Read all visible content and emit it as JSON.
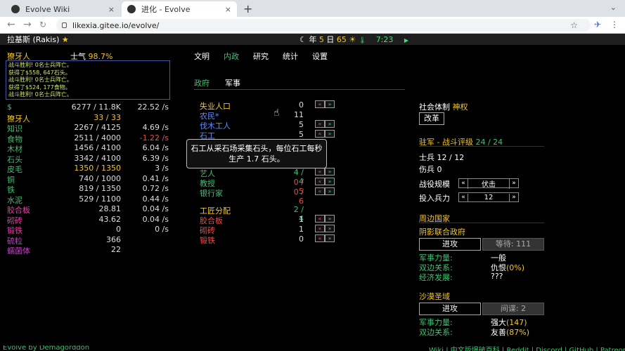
{
  "browser": {
    "tabs": [
      {
        "title": "Evolve Wiki",
        "close": "×"
      },
      {
        "title": "进化 - Evolve",
        "close": "×"
      }
    ],
    "new_tab": "+",
    "url": "likexia.gitee.io/evolve/",
    "nav": {
      "back": "←",
      "forward": "→",
      "reload": "C"
    }
  },
  "topbar": {
    "race": "拉基斯 (Rakis)",
    "star": "★",
    "moon": "☾",
    "year_prefix": "年",
    "year": "5",
    "day_prefix": "日",
    "day": "65",
    "weather": "☀",
    "temp": "🌡",
    "time": "7:23",
    "play": "▶"
  },
  "population": {
    "name": "獠牙人",
    "morale_label": "士气",
    "morale_value": "98.7%"
  },
  "log": [
    "战斗胜利! 0名士兵阵亡。",
    "获得了$558, 647石头。",
    "战斗胜利! 0名士兵阵亡。",
    "获得了$524, 177食物。",
    "战斗胜利! 0名士兵阵亡。"
  ],
  "resources": [
    {
      "name": "$",
      "amount": "6277 / 11.8K",
      "rate": "22.52 /s",
      "color": "#40c070",
      "amount_color": "#ddd",
      "rate_color": "#ddd"
    },
    {
      "name": "獠牙人",
      "amount": "33 / 33",
      "rate": "",
      "color": "#f3c623",
      "amount_color": "#f3c623",
      "rate_color": "#ddd"
    },
    {
      "name": "知识",
      "amount": "2267 / 4125",
      "rate": "4.69 /s",
      "color": "#40c070",
      "amount_color": "#ddd",
      "rate_color": "#ddd"
    },
    {
      "name": "食物",
      "amount": "2511 / 4000",
      "rate": "-1.22 /s",
      "color": "#40c070",
      "amount_color": "#ddd",
      "rate_color": "#e05050"
    },
    {
      "name": "木材",
      "amount": "1456 / 4100",
      "rate": "6.04 /s",
      "color": "#40c070",
      "amount_color": "#ddd",
      "rate_color": "#ddd"
    },
    {
      "name": "石头",
      "amount": "3342 / 4100",
      "rate": "6.39 /s",
      "color": "#40c070",
      "amount_color": "#ddd",
      "rate_color": "#ddd"
    },
    {
      "name": "皮毛",
      "amount": "1350 / 1350",
      "rate": "3 /s",
      "color": "#40c070",
      "amount_color": "#f3c623",
      "rate_color": "#ddd"
    },
    {
      "name": "铜",
      "amount": "740 / 1000",
      "rate": "0.41 /s",
      "color": "#40c070",
      "amount_color": "#ddd",
      "rate_color": "#ddd"
    },
    {
      "name": "铁",
      "amount": "819 / 1350",
      "rate": "0.72 /s",
      "color": "#40c070",
      "amount_color": "#ddd",
      "rate_color": "#ddd"
    },
    {
      "name": "水泥",
      "amount": "529 / 1100",
      "rate": "0.44 /s",
      "color": "#40c070",
      "amount_color": "#ddd",
      "rate_color": "#ddd"
    },
    {
      "name": "胶合板",
      "amount": "28.81",
      "rate": "0.04 /s",
      "color": "#e040a0",
      "amount_color": "#ddd",
      "rate_color": "#ddd"
    },
    {
      "name": "砌砖",
      "amount": "43.62",
      "rate": "0.04 /s",
      "color": "#e040a0",
      "amount_color": "#ddd",
      "rate_color": "#ddd"
    },
    {
      "name": "锻铁",
      "amount": "0",
      "rate": "0 /s",
      "color": "#e040a0",
      "amount_color": "#ddd",
      "rate_color": "#ddd"
    },
    {
      "name": "硫粒",
      "amount": "366",
      "rate": "",
      "color": "#c040c0",
      "amount_color": "#ddd",
      "rate_color": "#ddd"
    },
    {
      "name": "蠕菌体",
      "amount": "22",
      "rate": "",
      "color": "#c040c0",
      "amount_color": "#ddd",
      "rate_color": "#ddd"
    }
  ],
  "main_tabs": [
    "文明",
    "内政",
    "研究",
    "统计",
    "设置"
  ],
  "sub_tabs": [
    "政府",
    "军事"
  ],
  "jobs": [
    {
      "name": "失业人口",
      "count": "0",
      "color": "#f3c623",
      "count_color": "#ddd",
      "controls": true
    },
    {
      "name": "农民*",
      "count": "11",
      "color": "#5b8cff",
      "count_color": "#ddd",
      "controls": false
    },
    {
      "name": "伐木工人",
      "count": "5",
      "color": "#5b8cff",
      "count_color": "#ddd",
      "controls": true
    },
    {
      "name": "石工",
      "count": "5",
      "color": "#5b8cff",
      "count_color": "#ddd",
      "controls": true
    },
    {
      "name": "艺人",
      "count": "4 / 4",
      "color": "#40c070",
      "count_color": "#40c070",
      "controls": true
    },
    {
      "name": "教授",
      "count": "0 / 5",
      "color": "#40c070",
      "count_color": "#e05050",
      "controls": true
    },
    {
      "name": "银行家",
      "count": "0 / 6",
      "color": "#40c070",
      "count_color": "#e05050",
      "controls": true
    }
  ],
  "crafting": {
    "title": "工匠分配",
    "count": "2 / 4"
  },
  "crafters": [
    {
      "name": "胶合板",
      "count": "1"
    },
    {
      "name": "砌砖",
      "count": "1"
    },
    {
      "name": "锻铁",
      "count": "0"
    }
  ],
  "controls": {
    "minus": "«",
    "plus": "»"
  },
  "tooltip": "石工从采石场采集石头，每位石工每秒生产 1.7 石头。",
  "government": {
    "label": "社会体制",
    "value": "神权",
    "button": "改革"
  },
  "garrison": {
    "title": "驻军 - 战斗评级",
    "rating": "24 / 24",
    "soldiers_label": "士兵",
    "soldiers": "12 / 12",
    "wounded_label": "伤兵",
    "wounded": "0",
    "campaign_label": "战役规模",
    "campaign": "伏击",
    "troops_label": "投入兵力",
    "troops": "12",
    "left": "«",
    "right": "»"
  },
  "foreign": {
    "title": "周边国家",
    "nations": [
      {
        "name": "阴影联合政府",
        "attack": "进攻",
        "other": "等待: 111",
        "stats": [
          {
            "label": "军事力量:",
            "value": "一般",
            "extra": ""
          },
          {
            "label": "双边关系:",
            "value": "仇恨",
            "extra": "(0%)"
          },
          {
            "label": "经济发展:",
            "value": "???",
            "extra": ""
          }
        ]
      },
      {
        "name": "沙漠圣域",
        "attack": "进攻",
        "other": "间谍: 2",
        "stats": [
          {
            "label": "军事力量:",
            "value": "强大",
            "extra": "(147)"
          },
          {
            "label": "双边关系:",
            "value": "友善",
            "extra": "(87%)"
          }
        ]
      }
    ]
  },
  "footer": {
    "left": "Evolve by Demagorddon",
    "right": "Wiki | 中文版爆破百科 | Reddit | Discord | GitHub | Patreon"
  }
}
